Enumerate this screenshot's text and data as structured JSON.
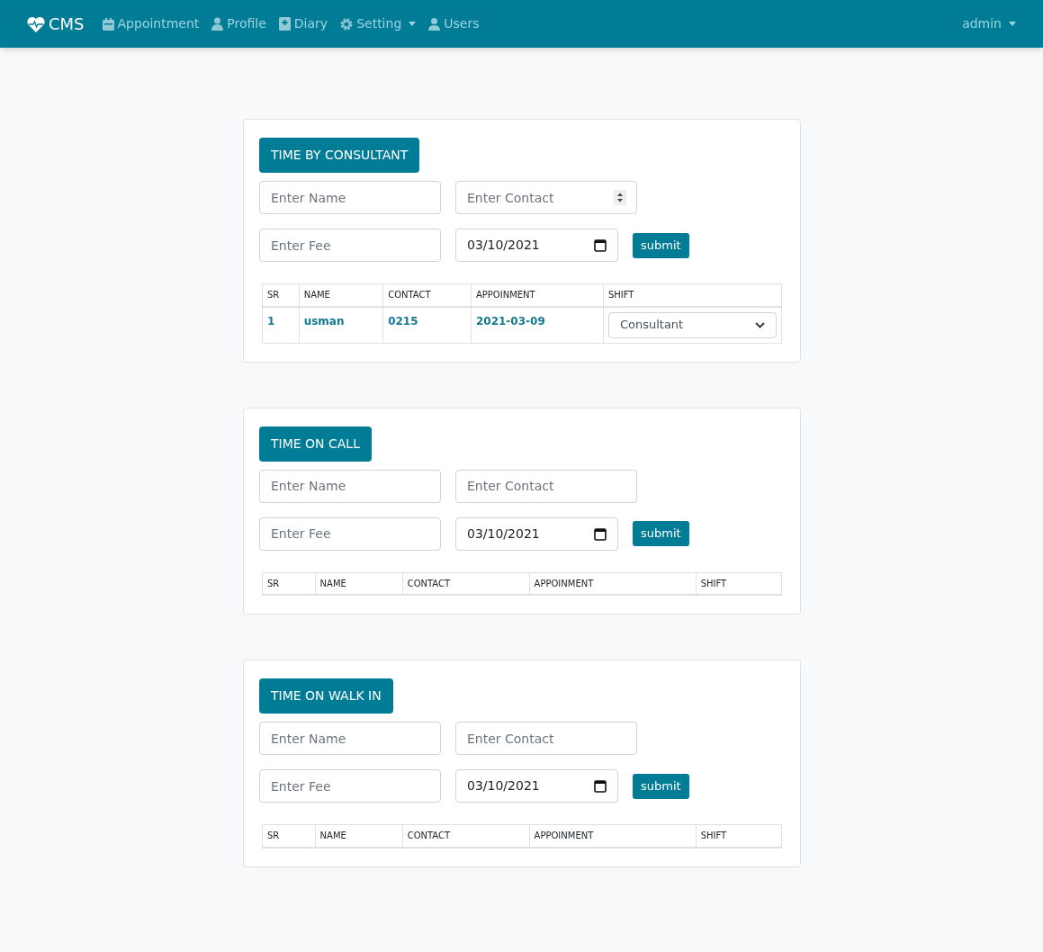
{
  "navbar": {
    "brand": "CMS",
    "items": [
      {
        "label": "Appointment",
        "dropdown": false
      },
      {
        "label": "Profile",
        "dropdown": false
      },
      {
        "label": "Diary",
        "dropdown": false
      },
      {
        "label": "Setting",
        "dropdown": true
      },
      {
        "label": "Users",
        "dropdown": false
      }
    ],
    "user_menu": {
      "label": "admin"
    }
  },
  "sections": [
    {
      "title": "TIME BY CONSULTANT",
      "name_placeholder": "Enter Name",
      "contact_placeholder": "Enter Contact",
      "contact_spinner": true,
      "fee_placeholder": "Enter Fee",
      "date": "03/10/2021",
      "submit": "submit",
      "columns": [
        "SR",
        "NAME",
        "CONTACT",
        "APPOINMENT",
        "SHIFT"
      ],
      "rows": [
        {
          "sr": "1",
          "name": "usman",
          "contact": "0215",
          "appointment": "2021-03-09",
          "shift": "Consultant"
        }
      ]
    },
    {
      "title": "TIME ON CALL",
      "name_placeholder": "Enter Name",
      "contact_placeholder": "Enter Contact",
      "contact_spinner": false,
      "fee_placeholder": "Enter Fee",
      "date": "03/10/2021",
      "submit": "submit",
      "columns": [
        "SR",
        "NAME",
        "CONTACT",
        "APPOINMENT",
        "SHIFT"
      ]
    },
    {
      "title": "TIME ON WALK IN",
      "name_placeholder": "Enter Name",
      "contact_placeholder": "Enter Contact",
      "contact_spinner": false,
      "fee_placeholder": "Enter Fee",
      "date": "03/10/2021",
      "submit": "submit",
      "columns": [
        "SR",
        "NAME",
        "CONTACT",
        "APPOINMENT",
        "SHIFT"
      ]
    }
  ]
}
